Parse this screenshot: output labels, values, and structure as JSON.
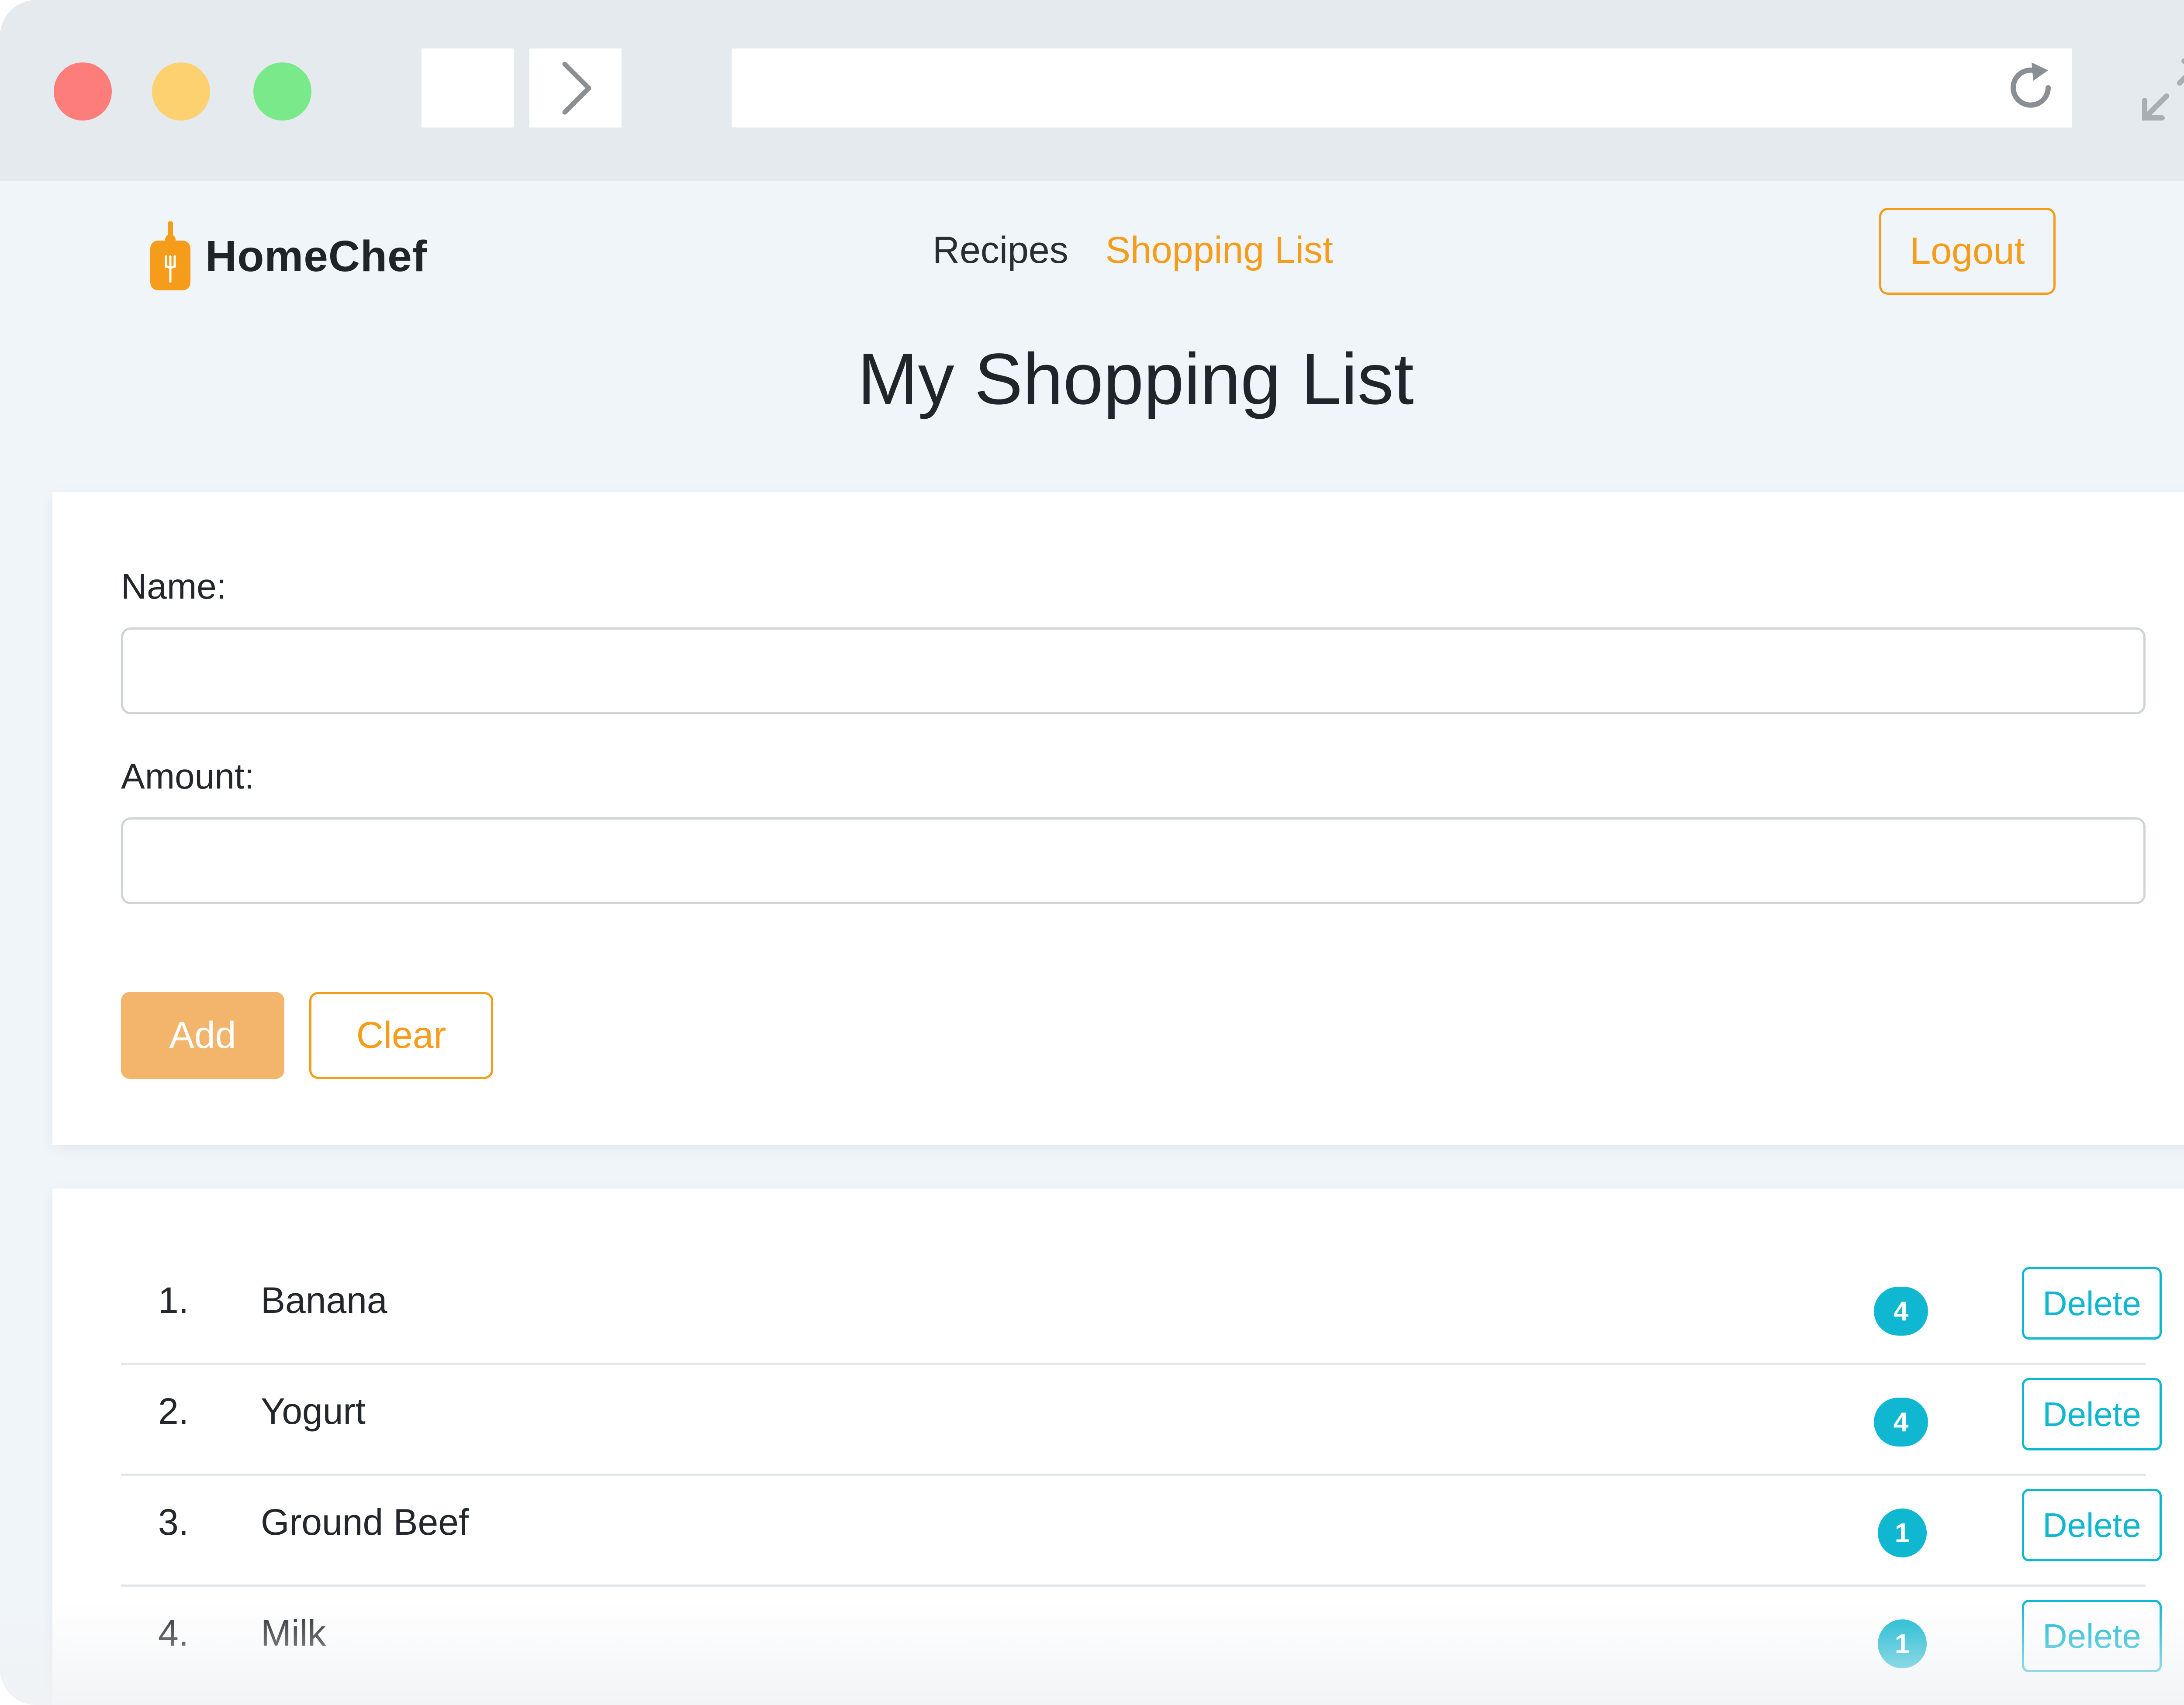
{
  "browser": {
    "url": "",
    "colors": {
      "close": "#fd7d7b",
      "minimize": "#fdd170",
      "maximize": "#79e98a"
    }
  },
  "brand": {
    "name": "HomeChef",
    "logo_icon": "cutting-board-icon"
  },
  "nav": {
    "items": [
      {
        "label": "Recipes",
        "active": false
      },
      {
        "label": "Shopping List",
        "active": true
      }
    ],
    "logout_label": "Logout"
  },
  "page": {
    "title": "My Shopping List"
  },
  "form": {
    "name_label": "Name:",
    "name_value": "",
    "amount_label": "Amount:",
    "amount_value": "",
    "add_label": "Add",
    "clear_label": "Clear"
  },
  "list": {
    "items": [
      {
        "index": "1.",
        "name": "Banana",
        "amount": "4",
        "delete_label": "Delete"
      },
      {
        "index": "2.",
        "name": "Yogurt",
        "amount": "4",
        "delete_label": "Delete"
      },
      {
        "index": "3.",
        "name": "Ground Beef",
        "amount": "1",
        "delete_label": "Delete"
      },
      {
        "index": "4.",
        "name": "Milk",
        "amount": "1",
        "delete_label": "Delete"
      }
    ]
  },
  "colors": {
    "accent": "#f59c1a",
    "badge": "#0fb7d1",
    "background": "#f0f5f9"
  }
}
